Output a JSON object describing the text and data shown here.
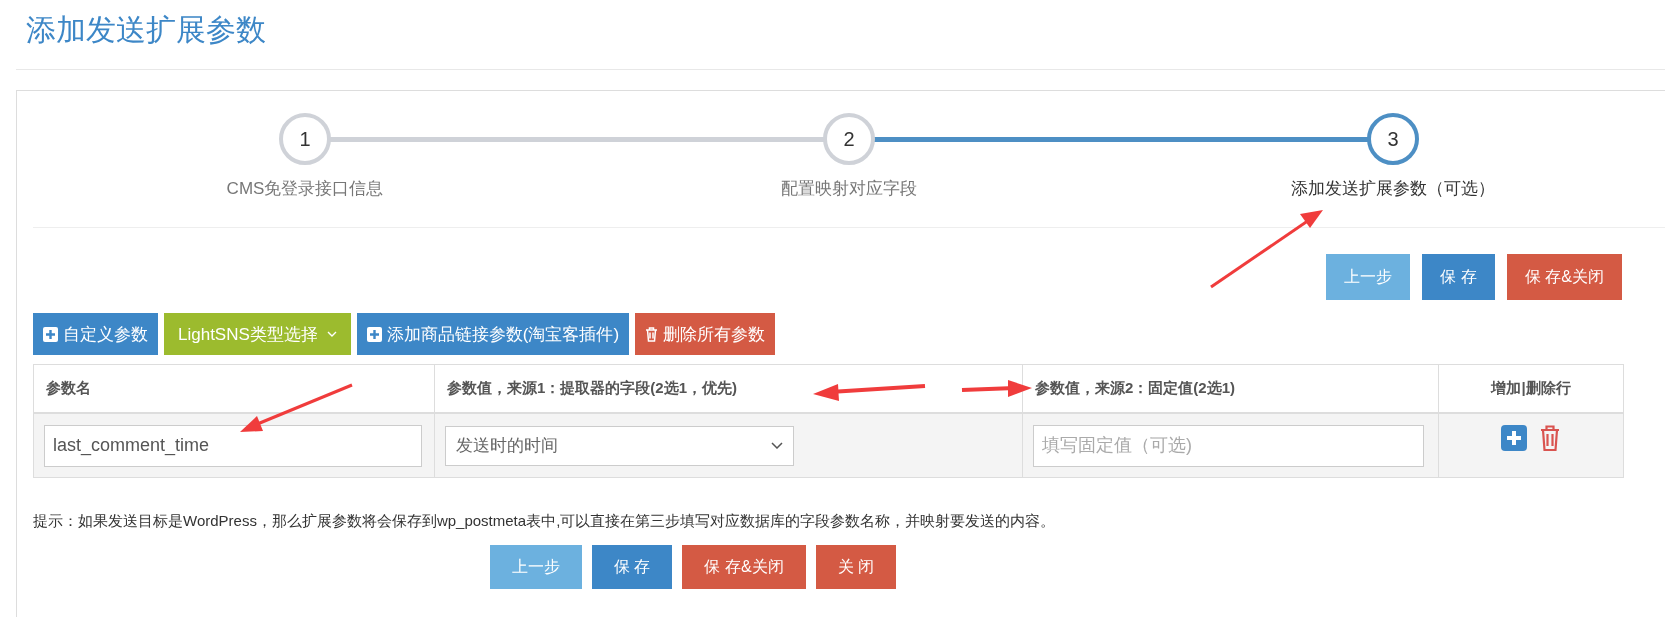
{
  "page_title": "添加发送扩展参数",
  "steps": [
    {
      "number": "1",
      "label": "CMS免登录接口信息",
      "selected": false
    },
    {
      "number": "2",
      "label": "配置映射对应字段",
      "selected": false
    },
    {
      "number": "3",
      "label": "添加发送扩展参数（可选）",
      "selected": true
    }
  ],
  "top_buttons": [
    {
      "label": "上一步",
      "kind": "light"
    },
    {
      "label": "保 存",
      "kind": "primary"
    },
    {
      "label": "保 存&关闭",
      "kind": "danger"
    }
  ],
  "toolbar": [
    {
      "label": "自定义参数",
      "kind": "primary"
    },
    {
      "label": "LightSNS类型选择",
      "kind": "olive"
    },
    {
      "label": "添加商品链接参数(淘宝客插件)",
      "kind": "primary"
    },
    {
      "label": "删除所有参数",
      "kind": "danger"
    }
  ],
  "table": {
    "columns": [
      "参数名",
      "参数值，来源1：提取器的字段(2选1，优先)",
      "参数值，来源2：固定值(2选1)",
      "增加|删除行"
    ],
    "rows": [
      {
        "name": "last_comment_time",
        "source_field": "发送时的时间",
        "fixed_value_placeholder": "填写固定值（可选)"
      }
    ]
  },
  "hint": "提示：如果发送目标是WordPress，那么扩展参数将会保存到wp_postmeta表中,可以直接在第三步填写对应数据库的字段参数名称，并映射要发送的内容。",
  "bottom_buttons": [
    {
      "label": "上一步",
      "kind": "light"
    },
    {
      "label": "保 存",
      "kind": "primary"
    },
    {
      "label": "保 存&关闭",
      "kind": "danger"
    },
    {
      "label": "关 闭",
      "kind": "danger"
    }
  ]
}
